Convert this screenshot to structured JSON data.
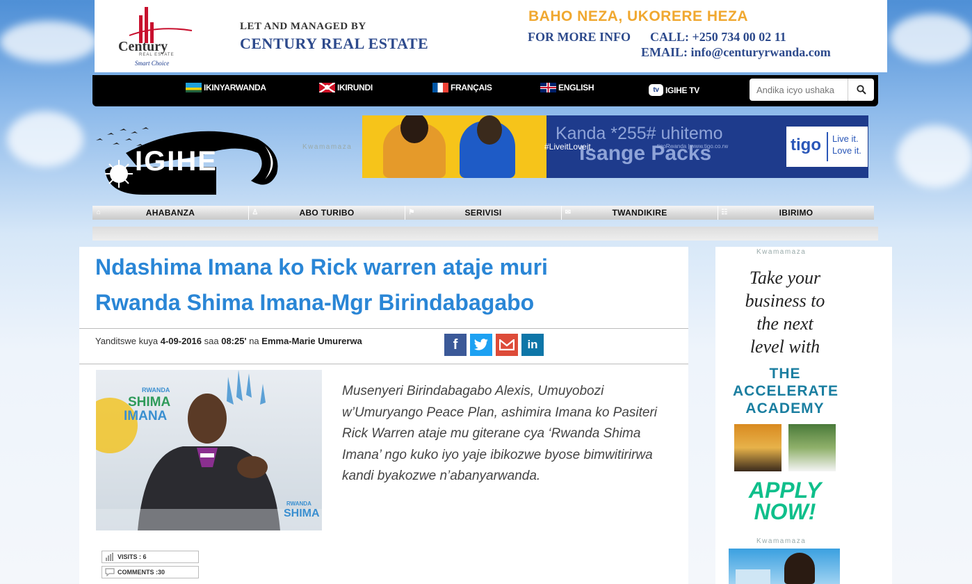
{
  "top_ad": {
    "brand": "Century",
    "brand_sub": "REAL ESTATE",
    "brand_tag": "Smart Choice",
    "let_managed": "LET AND MANAGED BY",
    "company": "CENTURY REAL ESTATE",
    "slogan": "BAHO NEZA, UKORERE HEZA",
    "more_info": "FOR MORE INFO",
    "call": "CALL: +250 734 00 02 11",
    "email": "EMAIL:  info@centuryrwanda.com"
  },
  "lang_bar": {
    "items": [
      {
        "label": "IKINYARWANDA"
      },
      {
        "label": "IKIRUNDI"
      },
      {
        "label": "FRANÇAIS"
      },
      {
        "label": "ENGLISH"
      },
      {
        "label": "IGIHE TV"
      }
    ],
    "tv_badge": "tv",
    "search_placeholder": "Andika icyo ushaka"
  },
  "logo": {
    "text": "IGIHE"
  },
  "ad_labels": {
    "kwamamaza": "Kwamamaza"
  },
  "tigo_ad": {
    "headline": "Kanda *255# uhitemo",
    "product": "Isange Packs",
    "hashtag": "#LiveitLoveit.",
    "social": "tigoRwanda | www.tigo.co.rw",
    "brand": "tigo",
    "slogan_1": "Live it.",
    "slogan_2": "Love it."
  },
  "nav": {
    "items": [
      {
        "label": "AHABANZA",
        "icon": "home-icon"
      },
      {
        "label": "ABO TURIBO",
        "icon": "people-icon"
      },
      {
        "label": "SERIVISI",
        "icon": "flag-icon"
      },
      {
        "label": "TWANDIKIRE",
        "icon": "mail-icon"
      },
      {
        "label": "IBIRIMO",
        "icon": "sitemap-icon"
      }
    ]
  },
  "article": {
    "title": "Ndashima Imana ko Rick warren ataje muri Rwanda Shima Imana-Mgr Birindabagabo",
    "meta_prefix": "Yanditswe kuya",
    "date": "4-09-2016",
    "meta_saa": "saa",
    "time": "08:25'",
    "meta_na": "na",
    "author": "Emma-Marie Umurerwa",
    "photo_sign_1": "RWANDA",
    "photo_sign_2": "SHIMA",
    "photo_sign_3": "IMANA",
    "photo_sign_4": "RWANDA",
    "photo_sign_5": "SHIMA",
    "lead": "Musenyeri Birindabagabo Alexis, Umuyobozi w’Umuryango Peace Plan, ashimira Imana ko Pasiteri Rick Warren ataje mu giterane cya ‘Rwanda Shima Imana’ ngo kuko iyo yaje ibikozwe byose bimwitirirwa kandi byakozwe n’abanyarwanda.",
    "visits": "VISITS : 6",
    "comments": "COMMENTS :30"
  },
  "share": [
    {
      "name": "facebook",
      "glyph": "f",
      "color": "#3b5998"
    },
    {
      "name": "twitter",
      "glyph": "t",
      "color": "#1da1f2"
    },
    {
      "name": "gmail",
      "glyph": "M",
      "color": "#dd4b39"
    },
    {
      "name": "linkedin",
      "glyph": "in",
      "color": "#0e76a8"
    }
  ],
  "side_ad": {
    "line1": "Take your",
    "line2": "business to",
    "line3": "the next",
    "line4": "level with",
    "the": "THE",
    "accelerate": "ACCELERATE",
    "academy": "ACADEMY",
    "apply": "APPLY",
    "now": "NOW!"
  }
}
